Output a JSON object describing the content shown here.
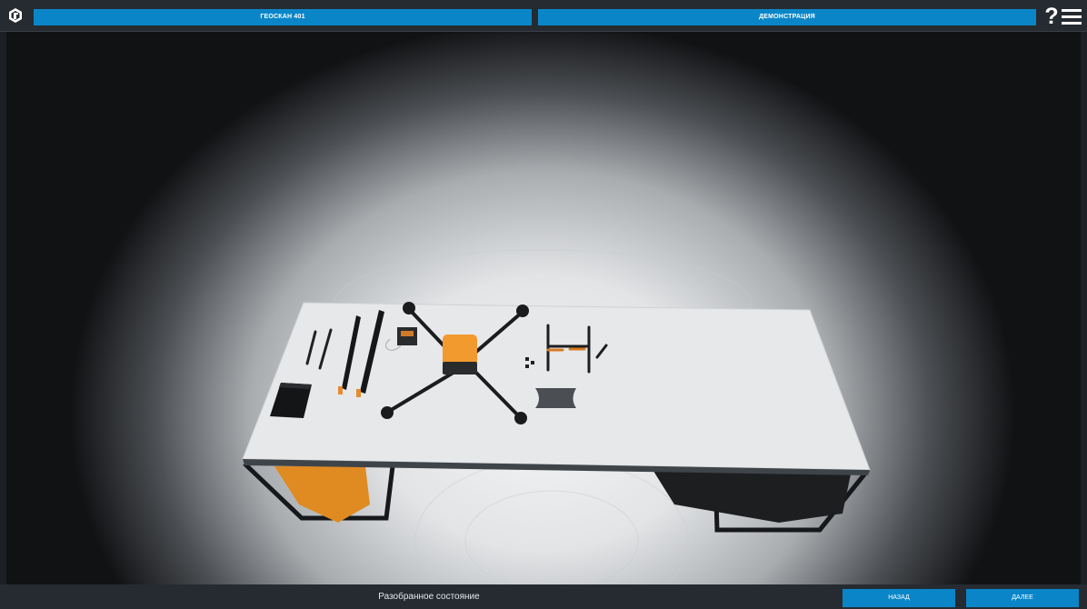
{
  "header": {
    "model_tab": "ГЕОСКАН 401",
    "mode_tab": "ДЕМОНСТРАЦИЯ",
    "help_label": "?"
  },
  "footer": {
    "state_label": "Разобранное состояние",
    "back_button": "НАЗАД",
    "next_button": "ДАЛЕЕ"
  },
  "colors": {
    "accent": "#0a86c8",
    "bar_background": "#262b31",
    "drone_body": "#f29a2e"
  },
  "icons": [
    "logo-icon",
    "help-icon",
    "menu-icon"
  ]
}
